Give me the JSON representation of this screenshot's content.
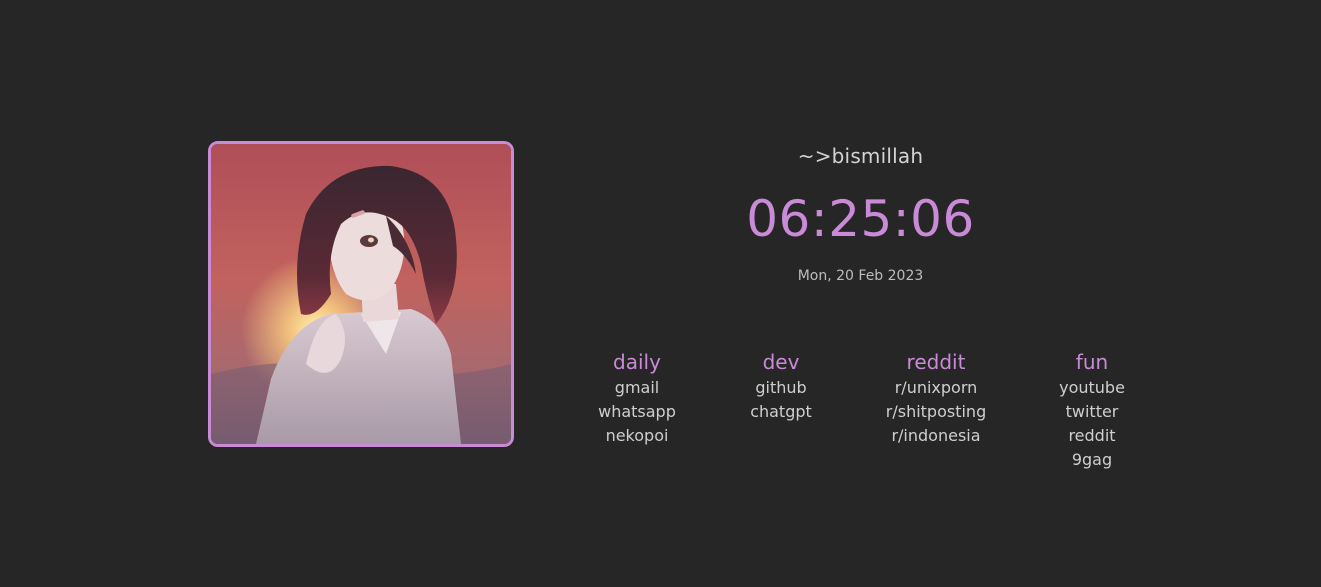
{
  "greeting": "~>bismillah",
  "clock": "06:25:06",
  "date": "Mon, 20 Feb 2023",
  "colors": {
    "background": "#262626",
    "accent": "#c98ad6",
    "text": "#cfcfcf"
  },
  "groups": [
    {
      "title": "daily",
      "links": [
        "gmail",
        "whatsapp",
        "nekopoi"
      ]
    },
    {
      "title": "dev",
      "links": [
        "github",
        "chatgpt"
      ]
    },
    {
      "title": "reddit",
      "links": [
        "r/unixporn",
        "r/shitposting",
        "r/indonesia"
      ]
    },
    {
      "title": "fun",
      "links": [
        "youtube",
        "twitter",
        "reddit",
        "9gag"
      ]
    }
  ]
}
